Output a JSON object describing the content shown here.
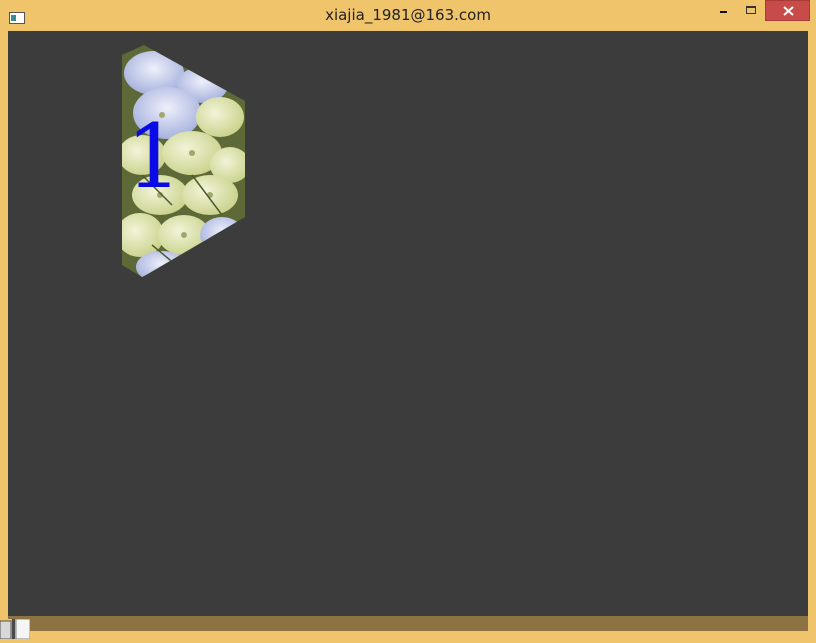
{
  "window": {
    "title": "xiajia_1981@163.com",
    "frame_color": "#efc46a",
    "client_color": "#3c3c3c",
    "close_color": "#c74b48"
  },
  "titlebar": {
    "app_icon": "window-app-icon",
    "minimize_icon": "minimize-icon",
    "maximize_icon": "maximize-icon",
    "close_icon": "close-icon"
  },
  "canvas": {
    "tile": {
      "image": "hydrangea-flowers",
      "number": "1",
      "number_color": "#0a0ae6"
    }
  },
  "taskbar": {
    "thumbnail_icon": "taskbar-thumbnail-icon"
  }
}
